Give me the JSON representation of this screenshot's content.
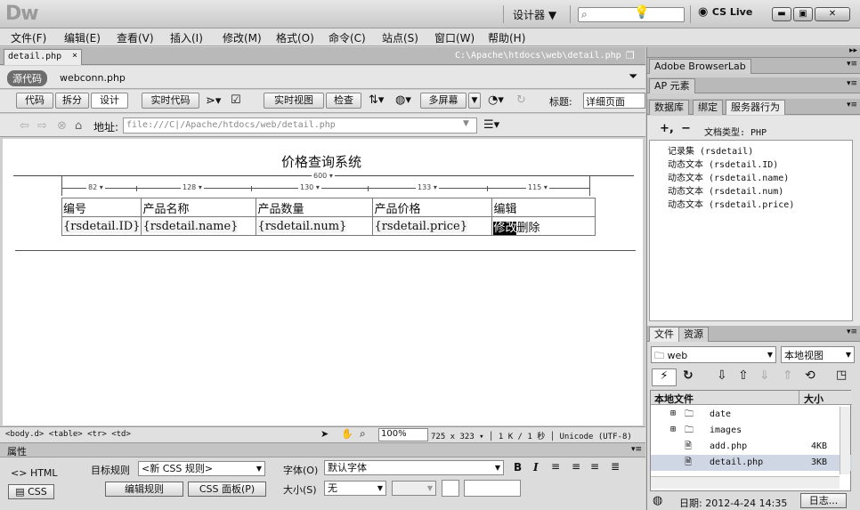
{
  "app": {
    "logo": "Dw",
    "workspace": "设计器 ▼",
    "search_placeholder": "",
    "cs_live": "CS Live",
    "win_min": "▬",
    "win_max": "▣",
    "win_close": "✕"
  },
  "menu": [
    "文件(F)",
    "编辑(E)",
    "查看(V)",
    "插入(I)",
    "修改(M)",
    "格式(O)",
    "命令(C)",
    "站点(S)",
    "窗口(W)",
    "帮助(H)"
  ],
  "doc": {
    "tab": "detail.php",
    "path": "C:\\Apache\\htdocs\\web\\detail.php",
    "source_code": "源代码",
    "related_file": "webconn.php"
  },
  "toolbar": {
    "code": "代码",
    "split": "拆分",
    "design": "设计",
    "live_code": "实时代码",
    "live_view": "实时视图",
    "inspect": "检查",
    "multiscreen": "多屏幕",
    "title_label": "标题:",
    "title_value": "详细页面"
  },
  "address": {
    "label": "地址:",
    "value": "file:///C|/Apache/htdocs/web/detail.php"
  },
  "page": {
    "title": "价格查询系统",
    "table_width": "600 ▾",
    "col_widths": [
      "82 ▾",
      "128 ▾",
      "130 ▾",
      "133 ▾",
      "115 ▾"
    ],
    "headers": [
      "编号",
      "产品名称",
      "产品数量",
      "产品价格",
      "编辑"
    ],
    "row": [
      "{rsdetail.ID}",
      "{rsdetail.name}",
      "{rsdetail.num}",
      "{rsdetail.price}"
    ],
    "edit": "修改",
    "delete": "删除"
  },
  "status": {
    "tags": "<body.d> <table> <tr> <td>",
    "zoom": "100%",
    "size": "725 x 323 ▾",
    "speed": "1 K / 1 秒",
    "encoding": "Unicode (UTF-8)"
  },
  "properties": {
    "title": "属性",
    "html": "HTML",
    "css": "CSS",
    "target_rule_label": "目标规则",
    "target_rule": "<新 CSS 规则>",
    "edit_rule": "编辑规则",
    "css_panel": "CSS 面板(P)",
    "font_label": "字体(O)",
    "font_value": "默认字体",
    "size_label": "大小(S)",
    "size_value": "无"
  },
  "panels": {
    "browserlab": "Adobe BrowserLab",
    "ap": "AP 元素",
    "tabs": [
      "数据库",
      "绑定",
      "服务器行为"
    ],
    "doc_type": "文档类型: PHP",
    "behaviors": [
      "记录集 (rsdetail)",
      "动态文本 (rsdetail.ID)",
      "动态文本 (rsdetail.name)",
      "动态文本 (rsdetail.num)",
      "动态文本 (rsdetail.price)"
    ],
    "files_tabs": [
      "文件",
      "资源"
    ],
    "site": "web",
    "view": "本地视图",
    "file_header": "本地文件",
    "size_header": "大小",
    "files": [
      {
        "name": "date",
        "size": "",
        "type": "folder"
      },
      {
        "name": "images",
        "size": "",
        "type": "folder"
      },
      {
        "name": "add.php",
        "size": "4KB",
        "type": "file"
      },
      {
        "name": "detail.php",
        "size": "3KB",
        "type": "file"
      }
    ],
    "date_label": "日期: 2012-4-24 14:35",
    "log": "日志..."
  }
}
